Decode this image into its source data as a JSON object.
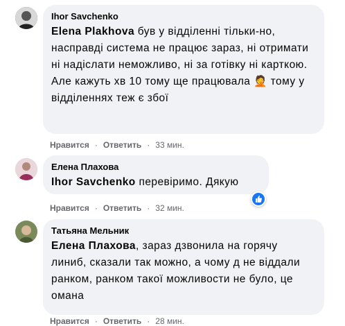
{
  "comments": [
    {
      "author": "Ihor Savchenko",
      "mention": "Elena Plakhova",
      "text": " був у відділенні тільки-но, насправді система не працює зараз, ні отримати ні надіслати неможливо, ні за готівку ні карткою. Але кажуть хв 10 тому ще працювала 🤦 тому у відділеннях теж є збої",
      "like_label": "Нравится",
      "reply_label": "Ответить",
      "time": "33 мин."
    },
    {
      "author": "Елена Плахова",
      "mention": "Ihor Savchenko",
      "text": " перевіримо. Дякую",
      "like_label": "Нравится",
      "reply_label": "Ответить",
      "time": "32 мин.",
      "reaction": "like-icon"
    },
    {
      "author": "Татьяна Мельник",
      "mention": "Елена Плахова",
      "text": ", зараз дзвонила на горячу линиб, сказали так можно, а чому д не віддали ранком, ранком такої можливости не було, це омана",
      "like_label": "Нравится",
      "reply_label": "Ответить",
      "time": "28 мин."
    }
  ],
  "colors": {
    "bubble": "#f0f2f5",
    "meta": "#65676b",
    "like_blue": "#1877f2"
  }
}
